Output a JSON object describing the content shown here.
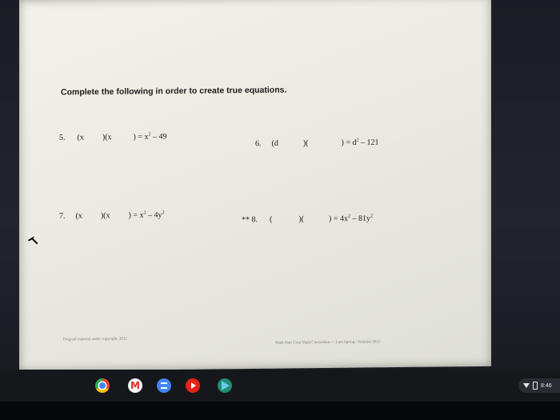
{
  "worksheet": {
    "instruction": "Complete the following in order to create true equations.",
    "problems": [
      {
        "label": "5.",
        "open": "(x",
        "mid": ")(x",
        "close": ")",
        "equals": "= x",
        "exp": "2",
        "tail": " – 49"
      },
      {
        "label": "6.",
        "open": "(d",
        "mid": ")(",
        "close": ")",
        "equals": "= d",
        "exp": "2",
        "tail": " – 121"
      },
      {
        "label": "7.",
        "open": "(x",
        "mid": ")(x",
        "close": ")",
        "equals": "= x",
        "exp": "2",
        "tail": " – 4y",
        "exp2": "2"
      },
      {
        "prefix": "**",
        "label": "8.",
        "open": "(",
        "mid": ")(",
        "close": ")",
        "equals": "= 4x",
        "exp": "2",
        "tail": " – 81y",
        "exp2": "2"
      }
    ],
    "footer_left": "Original material under copyright, 2012",
    "footer_right": "Math Start Core Math Curriculum — Late Spring / Summer 2021"
  },
  "shelf": {
    "apps": [
      "chrome-icon",
      "gmail-icon",
      "docs-icon",
      "youtube-icon",
      "play-store-icon"
    ],
    "clock": "8:46"
  },
  "colors": {
    "paper": "#ebeae1",
    "shelf": "#16171b",
    "text": "#1b1b1b"
  }
}
